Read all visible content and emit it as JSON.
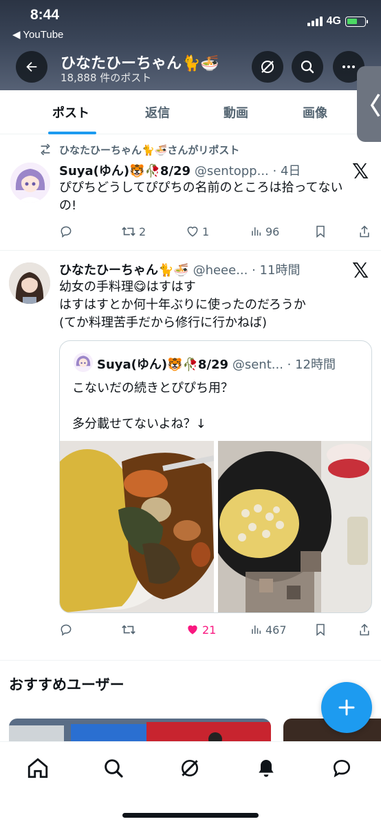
{
  "status_bar": {
    "time": "8:44",
    "back_app": "◀ YouTube",
    "network": "4G"
  },
  "profile": {
    "name": "ひなたひーちゃん🐈🍜",
    "post_count": "18,888 件のポスト"
  },
  "tabs": [
    {
      "label": "ポスト",
      "active": true
    },
    {
      "label": "返信",
      "active": false
    },
    {
      "label": "動画",
      "active": false
    },
    {
      "label": "画像",
      "active": false
    }
  ],
  "post1": {
    "repost_label": "ひなたひーちゃん🐈🍜さんがリポスト",
    "author_name": "Suya(ゆん)🐯🥀8/29",
    "handle": "@sentopp...",
    "time": "· 4日",
    "text_line1": "ぴぴちどうしてぴぴちの名前のところは拾ってない",
    "text_line2": "の!",
    "reposts": "2",
    "likes": "1",
    "views": "96"
  },
  "post2": {
    "author_name": "ひなたひーちゃん🐈🍜",
    "handle": "@heee...",
    "time": "· 11時間",
    "text_line1": "幼女の手料理😋はすはす",
    "text_line2": "はすはすとか何十年ぶりに使ったのだろうか",
    "text_line3": "(てか料理苦手だから修行に行かねば)",
    "likes": "21",
    "views": "467",
    "quote": {
      "author_name": "Suya(ゆん)🐯🥀8/29",
      "handle": "@sent...",
      "time": "· 12時間",
      "text_line1": "こないだの続きとぴぴち用？",
      "text_line2": "多分載せてないよね？↓"
    }
  },
  "recommended": {
    "title": "おすすめユーザー"
  },
  "colors": {
    "accent": "#1d9bf0",
    "like_active": "#f91880",
    "muted": "#536471"
  }
}
